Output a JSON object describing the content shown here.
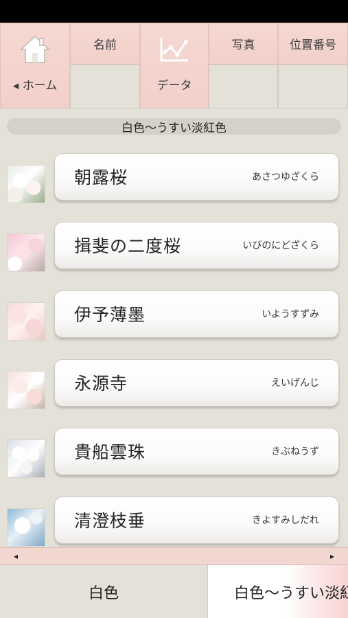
{
  "nav": {
    "home_label": "◂ ホーム",
    "name_label": "名前",
    "data_label": "データ",
    "photo_label": "写真",
    "position_label": "位置番号"
  },
  "section_title": "白色～うすい淡紅色",
  "items": [
    {
      "name": "朝露桜",
      "reading": "あさつゆざくら"
    },
    {
      "name": "揖斐の二度桜",
      "reading": "いびのにどざくら"
    },
    {
      "name": "伊予薄墨",
      "reading": "いようすずみ"
    },
    {
      "name": "永源寺",
      "reading": "えいげんじ"
    },
    {
      "name": "貴船雲珠",
      "reading": "きぶねうず"
    },
    {
      "name": "清澄枝垂",
      "reading": "きよすみしだれ"
    }
  ],
  "scroll": {
    "left_arrow": "◂",
    "right_arrow": "▸"
  },
  "categories": [
    "白色",
    "白色～うすい淡紅色"
  ],
  "colors": {
    "tab_pink": "#f3d3cc",
    "background": "#e4e1d9"
  },
  "icons": {
    "home": "home-icon",
    "data": "chart-icon"
  }
}
